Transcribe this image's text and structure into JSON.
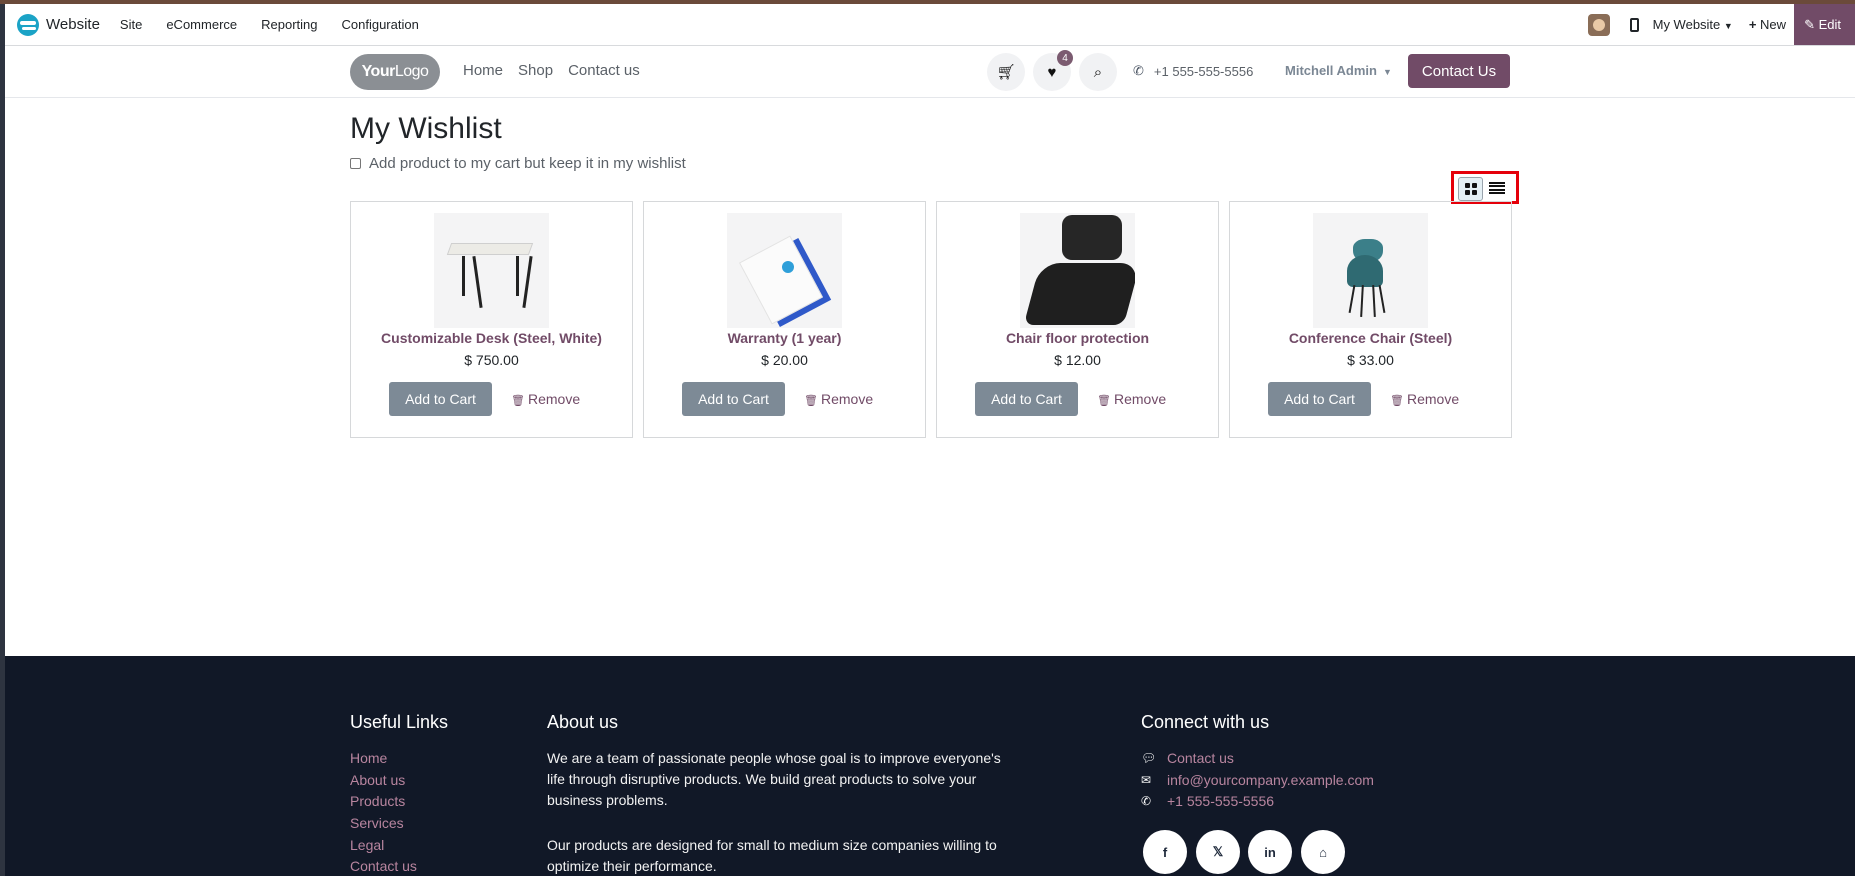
{
  "admin_bar": {
    "brand": "Website",
    "menu": [
      "Site",
      "eCommerce",
      "Reporting",
      "Configuration"
    ],
    "my_website": "My Website",
    "new_label": "New",
    "edit_label": "Edit"
  },
  "site_header": {
    "logo_bold": "Your",
    "logo_light": "Logo",
    "nav": [
      "Home",
      "Shop",
      "Contact us"
    ],
    "wishlist_count": "4",
    "phone": "+1 555-555-5556",
    "user": "Mitchell Admin",
    "contact_button": "Contact Us"
  },
  "wishlist": {
    "title": "My Wishlist",
    "keep_label": "Add product to my cart but keep it in my wishlist",
    "add_to_cart_label": "Add to Cart",
    "remove_label": "Remove",
    "products": [
      {
        "name": "Customizable Desk (Steel, White)",
        "price": "$ 750.00"
      },
      {
        "name": "Warranty (1 year)",
        "price": "$ 20.00"
      },
      {
        "name": "Chair floor protection",
        "price": "$ 12.00"
      },
      {
        "name": "Conference Chair (Steel)",
        "price": "$ 33.00"
      }
    ]
  },
  "footer": {
    "useful_links_title": "Useful Links",
    "links": [
      "Home",
      "About us",
      "Products",
      "Services",
      "Legal",
      "Contact us"
    ],
    "about_title": "About us",
    "about_lines_1": [
      "We are a team of passionate people whose goal is to improve everyone's",
      "life through disruptive products. We build great products to solve your",
      "business problems."
    ],
    "about_lines_2": [
      "Our products are designed for small to medium size companies willing to",
      "optimize their performance."
    ],
    "connect_title": "Connect with us",
    "contact_us": "Contact us",
    "email": "info@yourcompany.example.com",
    "phone": "+1 555-555-5556",
    "social_icons": [
      "facebook-icon",
      "x-twitter-icon",
      "linkedin-icon",
      "home-icon"
    ]
  },
  "colors": {
    "brand": "#714b67",
    "footer_bg": "#111827",
    "highlight": "#e5000a",
    "button_grey": "#7d8a96"
  }
}
